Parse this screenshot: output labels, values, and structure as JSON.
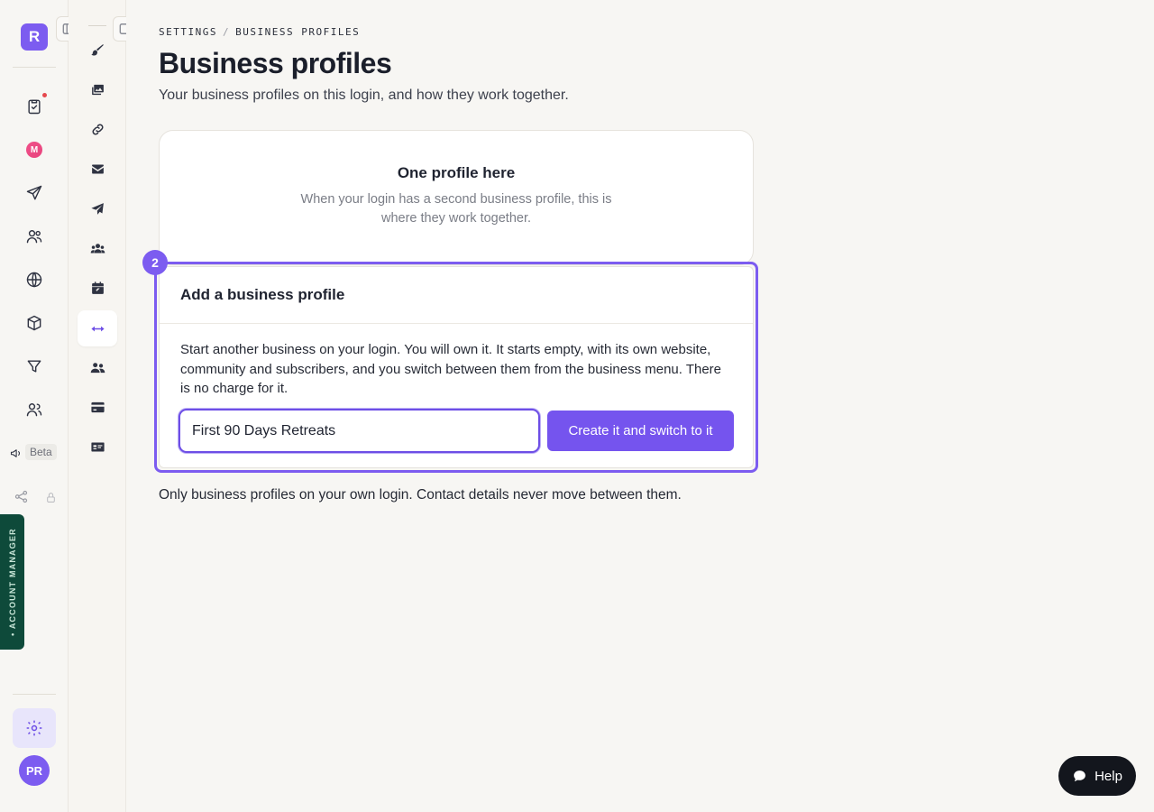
{
  "rail": {
    "brand_letter": "R",
    "beta_label": "Beta",
    "account_manager_label": "• ACCOUNT MANAGER",
    "avatar_initials": "PR",
    "icons": [
      "tasks-icon",
      "m-app-icon",
      "send-icon",
      "contacts-icon",
      "globe-icon",
      "box-icon",
      "filter-icon",
      "users-icon",
      "megaphone-icon",
      "share-icon",
      "lock-icon",
      "settings-icon"
    ]
  },
  "subnav": {
    "icons": [
      "brush-icon",
      "images-icon",
      "link-icon",
      "envelope-icon",
      "paper-plane-icon",
      "team-icon",
      "calendar-icon",
      "arrows-horizontal-icon",
      "people-icon",
      "credit-card-icon",
      "id-card-icon"
    ],
    "active": "arrows-horizontal-icon"
  },
  "breadcrumb": {
    "parent": "SETTINGS",
    "separator": "/",
    "current": "BUSINESS PROFILES"
  },
  "page": {
    "title": "Business profiles",
    "subtitle": "Your business profiles on this login, and how they work together."
  },
  "empty_card": {
    "title": "One profile here",
    "body": "When your login has a second business profile, this is where they work together."
  },
  "step_badge": "2",
  "add_card": {
    "title": "Add a business profile",
    "description": "Start another business on your login. You will own it. It starts empty, with its own website, community and subscribers, and you switch between them from the business menu. There is no charge for it.",
    "input_value": "First 90 Days Retreats",
    "button_label": "Create it and switch to it"
  },
  "footnote": "Only business profiles on your own login. Contact details never move between them.",
  "help_label": "Help",
  "colors": {
    "accent": "#7c5cf0",
    "account_tab": "#0e4a3a",
    "help_button": "#13161d"
  }
}
